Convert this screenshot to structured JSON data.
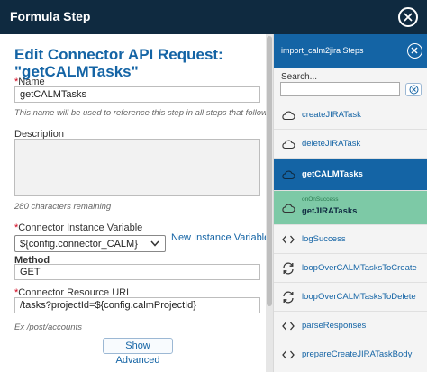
{
  "header": {
    "title": "Formula Step"
  },
  "form": {
    "title_line1": "Edit Connector API Request:",
    "title_line2": "\"getCALMTasks\"",
    "name_label": "Name",
    "name_value": "getCALMTasks",
    "name_hint": "This name will be used to reference this step in all steps that follow.",
    "description_label": "Description",
    "chars_remaining": "280 characters remaining",
    "connector_label": "Connector Instance Variable",
    "connector_value": "${config.connector_CALM}",
    "new_instance_link": "New Instance Variable",
    "method_label": "Method",
    "method_value": "GET",
    "resource_label": "Connector Resource URL",
    "resource_value": "/tasks?projectId=${config.calmProjectId}",
    "resource_hint": "Ex /post/accounts",
    "show_advanced": "Show Advanced",
    "required_mark": "*"
  },
  "steps_panel": {
    "title": "import_calm2jira Steps",
    "search_label": "Search...",
    "search_value": "",
    "items": [
      {
        "name": "createJIRATask",
        "icon": "cloud-icon"
      },
      {
        "name": "deleteJIRATask",
        "icon": "cloud-icon"
      },
      {
        "name": "getCALMTasks",
        "icon": "cloud-icon"
      },
      {
        "name": "getJIRATasks",
        "icon": "cloud-icon",
        "sub": "onOnSuccess"
      },
      {
        "name": "logSuccess",
        "icon": "code-icon"
      },
      {
        "name": "loopOverCALMTasksToCreate",
        "icon": "loop-icon"
      },
      {
        "name": "loopOverCALMTasksToDelete",
        "icon": "loop-icon"
      },
      {
        "name": "parseResponses",
        "icon": "code-icon"
      },
      {
        "name": "prepareCreateJIRATaskBody",
        "icon": "code-icon"
      }
    ]
  },
  "colors": {
    "header": "#0f2a40",
    "accent": "#1464a5",
    "success": "#7dc9a6",
    "required": "#d0021b"
  }
}
